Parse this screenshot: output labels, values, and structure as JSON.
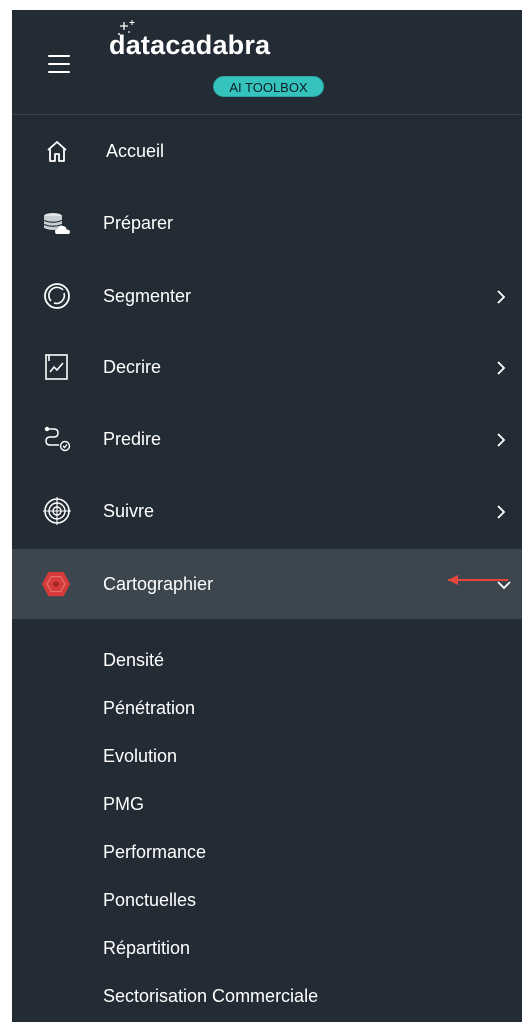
{
  "brand": {
    "name": "datacadabra",
    "badge": "AI TOOLBOX"
  },
  "colors": {
    "sidebar_bg": "#232c35",
    "active_bg": "#3b464f",
    "badge_bg": "#35c3be",
    "carto_icon": "#d63a3a",
    "annotation_arrow": "#e8463a"
  },
  "nav": {
    "items": [
      {
        "label": "Accueil",
        "icon": "home-icon",
        "has_chevron": false
      },
      {
        "label": "Préparer",
        "icon": "database-cloud-icon",
        "has_chevron": false
      },
      {
        "label": "Segmenter",
        "icon": "segment-ring-icon",
        "has_chevron": true
      },
      {
        "label": "Decrire",
        "icon": "chart-report-icon",
        "has_chevron": true
      },
      {
        "label": "Predire",
        "icon": "path-predict-icon",
        "has_chevron": true
      },
      {
        "label": "Suivre",
        "icon": "target-icon",
        "has_chevron": true
      },
      {
        "label": "Cartographier",
        "icon": "hexagon-map-icon",
        "has_chevron": true,
        "expanded": true,
        "active": true
      }
    ]
  },
  "submenu": {
    "items": [
      "Densité",
      "Pénétration",
      "Evolution",
      "PMG",
      "Performance",
      "Ponctuelles",
      "Répartition",
      "Sectorisation Commerciale"
    ]
  }
}
